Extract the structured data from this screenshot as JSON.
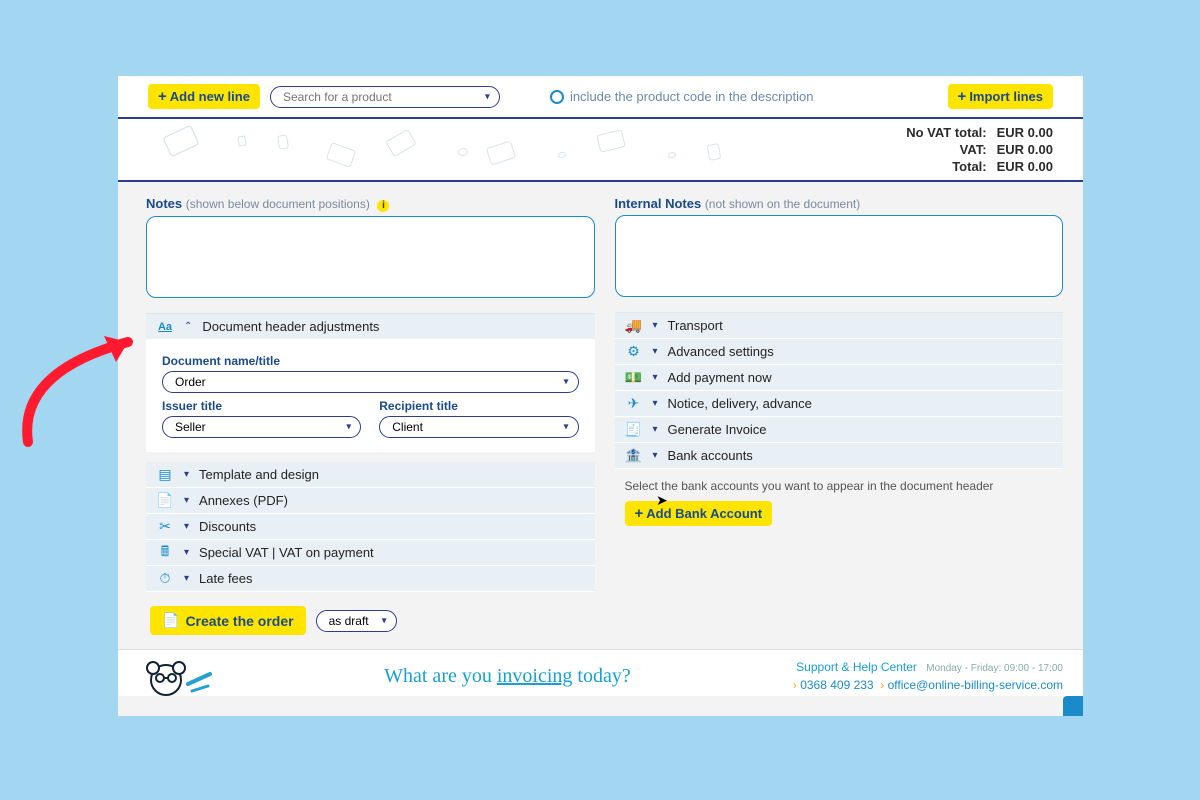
{
  "topbar": {
    "add_new_line": "Add new line",
    "search_placeholder": "Search for a product",
    "include_code": "include the product code in the description",
    "import_lines": "Import lines"
  },
  "totals": {
    "no_vat_label": "No VAT total:",
    "no_vat_value": "EUR 0.00",
    "vat_label": "VAT:",
    "vat_value": "EUR 0.00",
    "total_label": "Total:",
    "total_value": "EUR 0.00"
  },
  "notes_left": {
    "label": "Notes",
    "sub": "(shown below document positions)"
  },
  "notes_right": {
    "label": "Internal Notes",
    "sub": "(not shown on the document)"
  },
  "header_adj": {
    "title": "Document header adjustments",
    "doc_name_label": "Document name/title",
    "doc_name_value": "Order",
    "issuer_label": "Issuer title",
    "issuer_value": "Seller",
    "recipient_label": "Recipient title",
    "recipient_value": "Client"
  },
  "left_sections": {
    "s0": "Template and design",
    "s1": "Annexes (PDF)",
    "s2": "Discounts",
    "s3": "Special VAT | VAT on payment",
    "s4": "Late fees"
  },
  "right_sections": {
    "s0": "Transport",
    "s1": "Advanced settings",
    "s2": "Add payment now",
    "s3": "Notice, delivery, advance",
    "s4": "Generate Invoice",
    "s5": "Bank accounts"
  },
  "bank_helper": "Select the bank accounts you want to appear in the document header",
  "add_bank": "Add Bank Account",
  "create": {
    "label": "Create the order",
    "draft": "as draft"
  },
  "footer": {
    "tagline_pre": "What are you ",
    "tagline_mid": "invoicing",
    "tagline_post": " today?",
    "support_title": "Support & Help Center",
    "hours": "Monday - Friday: 09:00 - 17:00",
    "phone": "0368 409 233",
    "email": "office@online-billing-service.com"
  }
}
